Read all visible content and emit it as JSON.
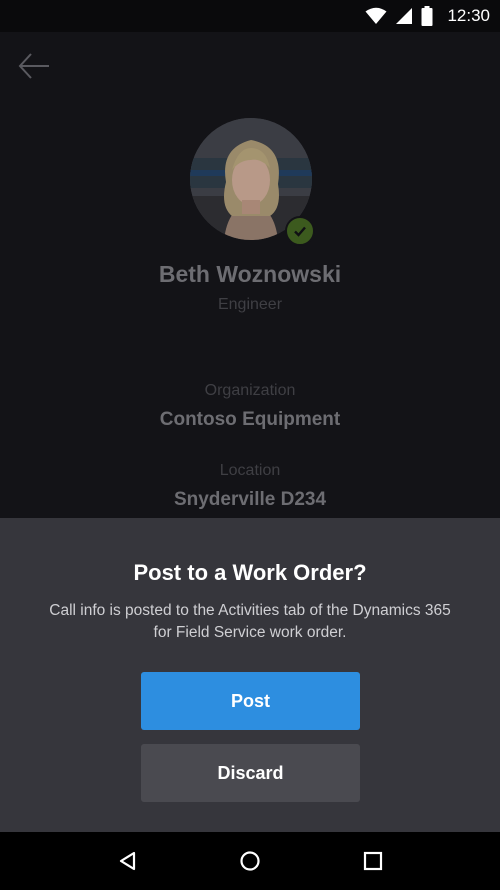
{
  "status_bar": {
    "time": "12:30",
    "icons": [
      "wifi-icon",
      "cellular-signal-icon",
      "battery-icon"
    ]
  },
  "profile": {
    "back_icon": "arrow-left-icon",
    "name": "Beth Woznowski",
    "role": "Engineer",
    "presence": "available",
    "organization_label": "Organization",
    "organization_value": "Contoso Equipment",
    "location_label": "Location",
    "location_value": "Snyderville D234"
  },
  "dialog": {
    "title": "Post to a Work Order?",
    "body": "Call info is posted to the Activities tab of the Dynamics 365 for Field Service work order.",
    "post_label": "Post",
    "discard_label": "Discard"
  },
  "nav_bar": {
    "icons": [
      "back-triangle-icon",
      "home-circle-icon",
      "recents-square-icon"
    ]
  },
  "colors": {
    "accent": "#2d8ee0",
    "sheet_background": "#36363c",
    "presence_green": "#3c5a1e"
  }
}
